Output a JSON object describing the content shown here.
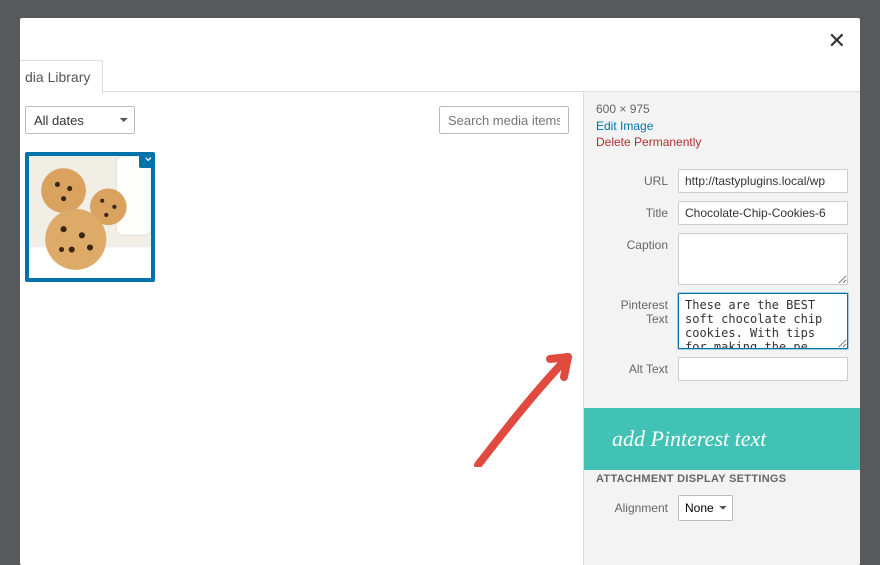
{
  "tabs": {
    "library": "dia Library"
  },
  "toolbar": {
    "date_filter": "All dates",
    "search_placeholder": "Search media items."
  },
  "attachment": {
    "dimensions": "600 × 975",
    "edit_label": "Edit Image",
    "delete_label": "Delete Permanently",
    "fields": {
      "url_label": "URL",
      "url_value": "http://tastyplugins.local/wp",
      "title_label": "Title",
      "title_value": "Chocolate-Chip-Cookies-6",
      "caption_label": "Caption",
      "caption_value": "",
      "pinterest_label": "Pinterest Text",
      "pinterest_value": "These are the BEST soft chocolate chip cookies. With tips for making the pe",
      "alt_label": "Alt Text",
      "alt_value": ""
    }
  },
  "callout": {
    "text": "add Pinterest text"
  },
  "display": {
    "section": "ATTACHMENT DISPLAY SETTINGS",
    "alignment_label": "Alignment",
    "alignment_value": "None"
  }
}
